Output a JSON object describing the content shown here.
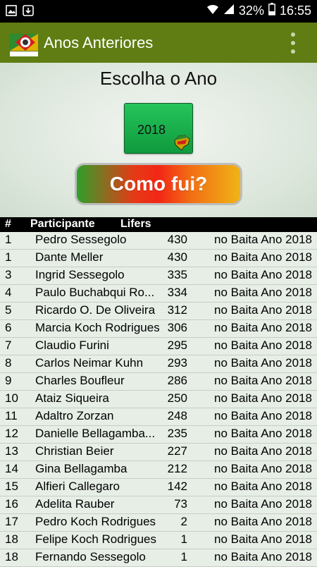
{
  "status_bar": {
    "battery": "32%",
    "time": "16:55",
    "left_icons": [
      "image-icon",
      "download-icon"
    ],
    "right_icons": [
      "wifi-icon",
      "signal-icon",
      "battery-icon"
    ]
  },
  "app_bar": {
    "logo_icon": "baita-logo-icon",
    "title": "Anos Anteriores",
    "menu_icon": "overflow-menu-icon"
  },
  "heading": "Escolha o Ano",
  "year_button": {
    "label": "2018",
    "icon": "rio-grande-do-sul-map-icon"
  },
  "action_button": {
    "label": "Como fui?"
  },
  "table": {
    "headers": {
      "rank": "#",
      "participant": "Participante",
      "lifers": "Lifers"
    },
    "rows": [
      {
        "rank": "1",
        "name": "Pedro Sessegolo",
        "lifers": "430",
        "label": "no Baita Ano 2018"
      },
      {
        "rank": "1",
        "name": "Dante Meller",
        "lifers": "430",
        "label": "no Baita Ano 2018"
      },
      {
        "rank": "3",
        "name": "Ingrid Sessegolo",
        "lifers": "335",
        "label": "no Baita Ano 2018"
      },
      {
        "rank": "4",
        "name": "Paulo Buchabqui Ro...",
        "lifers": "334",
        "label": "no Baita Ano 2018"
      },
      {
        "rank": "5",
        "name": "Ricardo O. De Oliveira",
        "lifers": "312",
        "label": "no Baita Ano 2018"
      },
      {
        "rank": "6",
        "name": "Marcia Koch Rodrigues",
        "lifers": "306",
        "label": "no Baita Ano 2018"
      },
      {
        "rank": "7",
        "name": "Claudio Furini",
        "lifers": "295",
        "label": "no Baita Ano 2018"
      },
      {
        "rank": "8",
        "name": "Carlos Neimar Kuhn",
        "lifers": "293",
        "label": "no Baita Ano 2018"
      },
      {
        "rank": "9",
        "name": "Charles Boufleur",
        "lifers": "286",
        "label": "no Baita Ano 2018"
      },
      {
        "rank": "10",
        "name": "Ataiz Siqueira",
        "lifers": "250",
        "label": "no Baita Ano 2018"
      },
      {
        "rank": "11",
        "name": "Adaltro Zorzan",
        "lifers": "248",
        "label": "no Baita Ano 2018"
      },
      {
        "rank": "12",
        "name": "Danielle Bellagamba...",
        "lifers": "235",
        "label": "no Baita Ano 2018"
      },
      {
        "rank": "13",
        "name": "Christian Beier",
        "lifers": "227",
        "label": "no Baita Ano 2018"
      },
      {
        "rank": "14",
        "name": "Gina Bellagamba",
        "lifers": "212",
        "label": "no Baita Ano 2018"
      },
      {
        "rank": "15",
        "name": "Alfieri Callegaro",
        "lifers": "142",
        "label": "no Baita Ano 2018"
      },
      {
        "rank": "16",
        "name": "Adelita Rauber",
        "lifers": "73",
        "label": "no Baita Ano 2018"
      },
      {
        "rank": "17",
        "name": "Pedro Koch Rodrigues",
        "lifers": "2",
        "label": "no Baita Ano 2018"
      },
      {
        "rank": "18",
        "name": "Felipe Koch Rodrigues",
        "lifers": "1",
        "label": "no Baita Ano 2018"
      },
      {
        "rank": "18",
        "name": "Fernando Sessegolo",
        "lifers": "1",
        "label": "no Baita Ano 2018"
      }
    ]
  }
}
